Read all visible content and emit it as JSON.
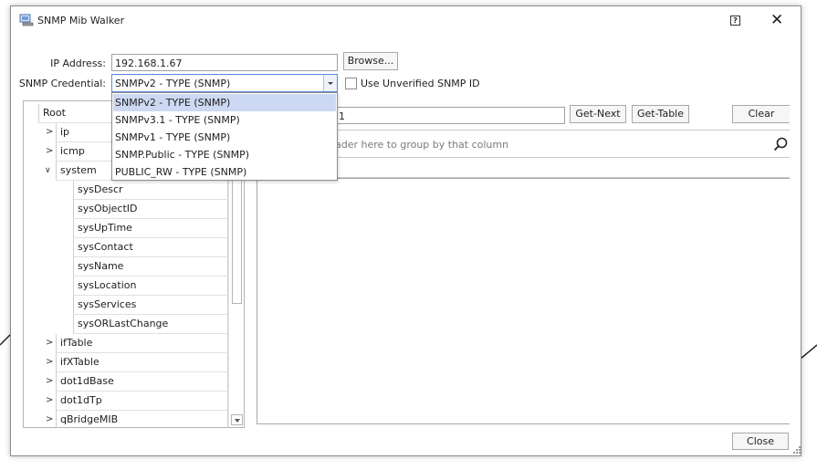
{
  "window": {
    "title": "SNMP Mib Walker",
    "help_glyph": "?",
    "close_glyph": "✕"
  },
  "form": {
    "ip_label": "IP Address:",
    "ip_value": "192.168.1.67",
    "browse_label": "Browse...",
    "credential_label": "SNMP Credential:",
    "credential_value": "SNMPv2 - TYPE (SNMP)",
    "unverified_label": "Use Unverified SNMP ID",
    "unverified_checked": false
  },
  "credential_options": [
    "SNMPv2 - TYPE (SNMP)",
    "SNMPv3.1 - TYPE (SNMP)",
    "SNMPv1 - TYPE (SNMP)",
    "SNMP.Public - TYPE (SNMP)",
    "PUBLIC_RW - TYPE (SNMP)"
  ],
  "tree": {
    "root": "Root",
    "level1": [
      "ip",
      "icmp",
      "system"
    ],
    "system_children": [
      "sysDescr",
      "sysObjectID",
      "sysUpTime",
      "sysContact",
      "sysName",
      "sysLocation",
      "sysServices",
      "sysORLastChange"
    ],
    "after_system": [
      "ifTable",
      "ifXTable",
      "dot1dBase",
      "dot1dTp",
      "qBridgeMIB"
    ]
  },
  "query": {
    "oid_value": "1",
    "get_next_label": "Get-Next",
    "get_table_label": "Get-Table",
    "clear_label": "Clear"
  },
  "grid": {
    "groupby_hint": "ader here to group by that column"
  },
  "footer": {
    "close_label": "Close"
  },
  "icons": {
    "app": "snmp-app-icon",
    "search": "search-icon",
    "help": "help-icon",
    "close": "close-icon"
  }
}
